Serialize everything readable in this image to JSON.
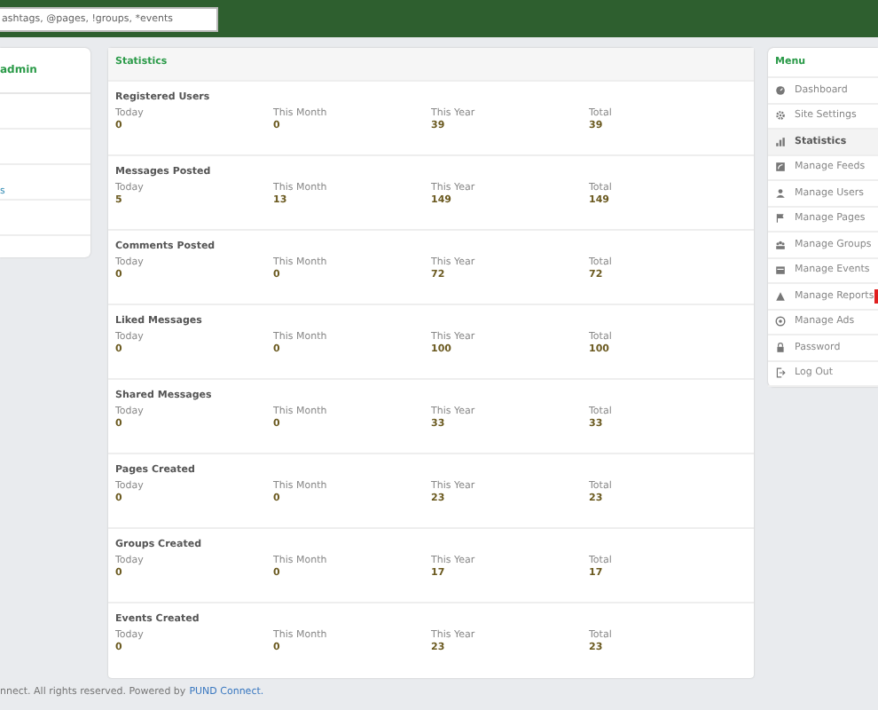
{
  "header": {
    "search": {
      "placeholder": "ashtags, @pages, !groups, *events"
    }
  },
  "profile_card": {
    "title": "admin",
    "rows": [
      "s"
    ]
  },
  "statistics": {
    "title": "Statistics",
    "sections": [
      {
        "title": "Registered Users",
        "stats": [
          {
            "label": "Today",
            "value": "0"
          },
          {
            "label": "This Month",
            "value": "0"
          },
          {
            "label": "This Year",
            "value": "39"
          },
          {
            "label": "Total",
            "value": "39"
          }
        ]
      },
      {
        "title": "Messages Posted",
        "stats": [
          {
            "label": "Today",
            "value": "5"
          },
          {
            "label": "This Month",
            "value": "13"
          },
          {
            "label": "This Year",
            "value": "149"
          },
          {
            "label": "Total",
            "value": "149"
          }
        ]
      },
      {
        "title": "Comments Posted",
        "stats": [
          {
            "label": "Today",
            "value": "0"
          },
          {
            "label": "This Month",
            "value": "0"
          },
          {
            "label": "This Year",
            "value": "72"
          },
          {
            "label": "Total",
            "value": "72"
          }
        ]
      },
      {
        "title": "Liked Messages",
        "stats": [
          {
            "label": "Today",
            "value": "0"
          },
          {
            "label": "This Month",
            "value": "0"
          },
          {
            "label": "This Year",
            "value": "100"
          },
          {
            "label": "Total",
            "value": "100"
          }
        ]
      },
      {
        "title": "Shared Messages",
        "stats": [
          {
            "label": "Today",
            "value": "0"
          },
          {
            "label": "This Month",
            "value": "0"
          },
          {
            "label": "This Year",
            "value": "33"
          },
          {
            "label": "Total",
            "value": "33"
          }
        ]
      },
      {
        "title": "Pages Created",
        "stats": [
          {
            "label": "Today",
            "value": "0"
          },
          {
            "label": "This Month",
            "value": "0"
          },
          {
            "label": "This Year",
            "value": "23"
          },
          {
            "label": "Total",
            "value": "23"
          }
        ]
      },
      {
        "title": "Groups Created",
        "stats": [
          {
            "label": "Today",
            "value": "0"
          },
          {
            "label": "This Month",
            "value": "0"
          },
          {
            "label": "This Year",
            "value": "17"
          },
          {
            "label": "Total",
            "value": "17"
          }
        ]
      },
      {
        "title": "Events Created",
        "stats": [
          {
            "label": "Today",
            "value": "0"
          },
          {
            "label": "This Month",
            "value": "0"
          },
          {
            "label": "This Year",
            "value": "23"
          },
          {
            "label": "Total",
            "value": "23"
          }
        ]
      }
    ]
  },
  "menu": {
    "title": "Menu",
    "items": [
      {
        "label": "Dashboard",
        "selected": false,
        "alert": false
      },
      {
        "label": "Site Settings",
        "selected": false,
        "alert": false
      },
      {
        "label": "Statistics",
        "selected": true,
        "alert": false
      },
      {
        "label": "Manage Feeds",
        "selected": false,
        "alert": false
      },
      {
        "label": "Manage Users",
        "selected": false,
        "alert": false
      },
      {
        "label": "Manage Pages",
        "selected": false,
        "alert": false
      },
      {
        "label": "Manage Groups",
        "selected": false,
        "alert": false
      },
      {
        "label": "Manage Events",
        "selected": false,
        "alert": false
      },
      {
        "label": "Manage Reports",
        "selected": false,
        "alert": true
      },
      {
        "label": "Manage Ads",
        "selected": false,
        "alert": false
      },
      {
        "label": "Password",
        "selected": false,
        "alert": false
      },
      {
        "label": "Log Out",
        "selected": false,
        "alert": false
      }
    ]
  },
  "footer": {
    "text": "nnect. All rights reserved. Powered by",
    "link": "PUND Connect."
  }
}
